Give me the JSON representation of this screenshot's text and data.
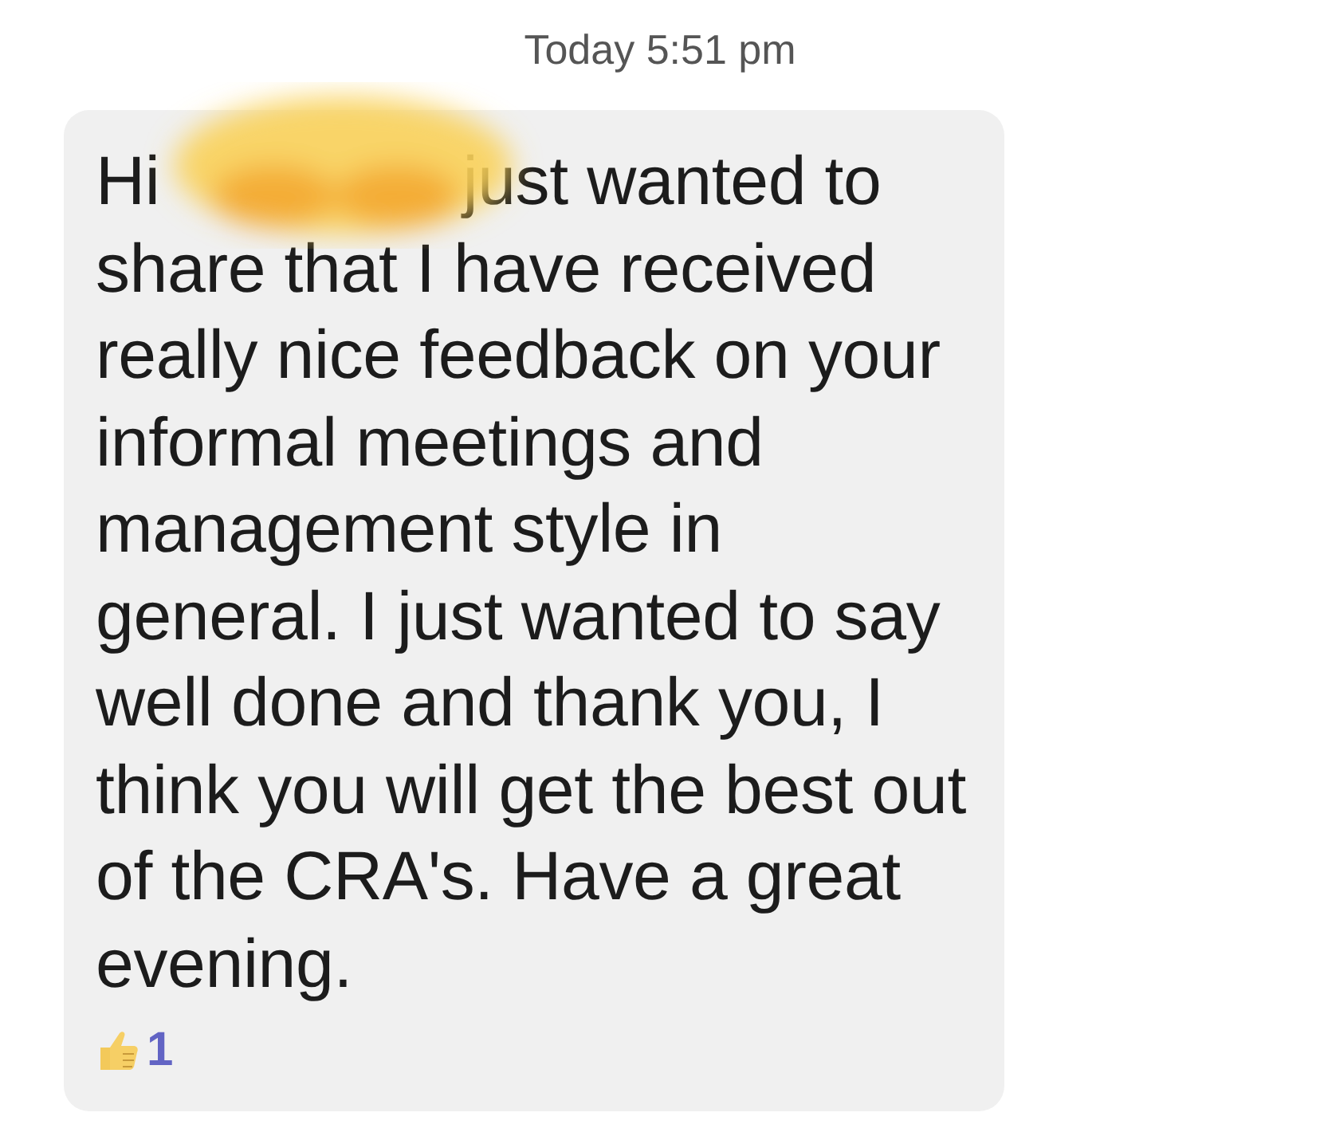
{
  "timestamp": "Today 5:51 pm",
  "message": {
    "greeting": "Hi",
    "body": "just wanted to share that I have received really nice feedback on your informal meetings and management style in general. I just wanted to say well done and thank you, I think you will get the best out of the CRA's. Have a great evening.",
    "redacted": true,
    "reactions": [
      {
        "kind": "thumbs-up",
        "count": "1"
      }
    ]
  }
}
